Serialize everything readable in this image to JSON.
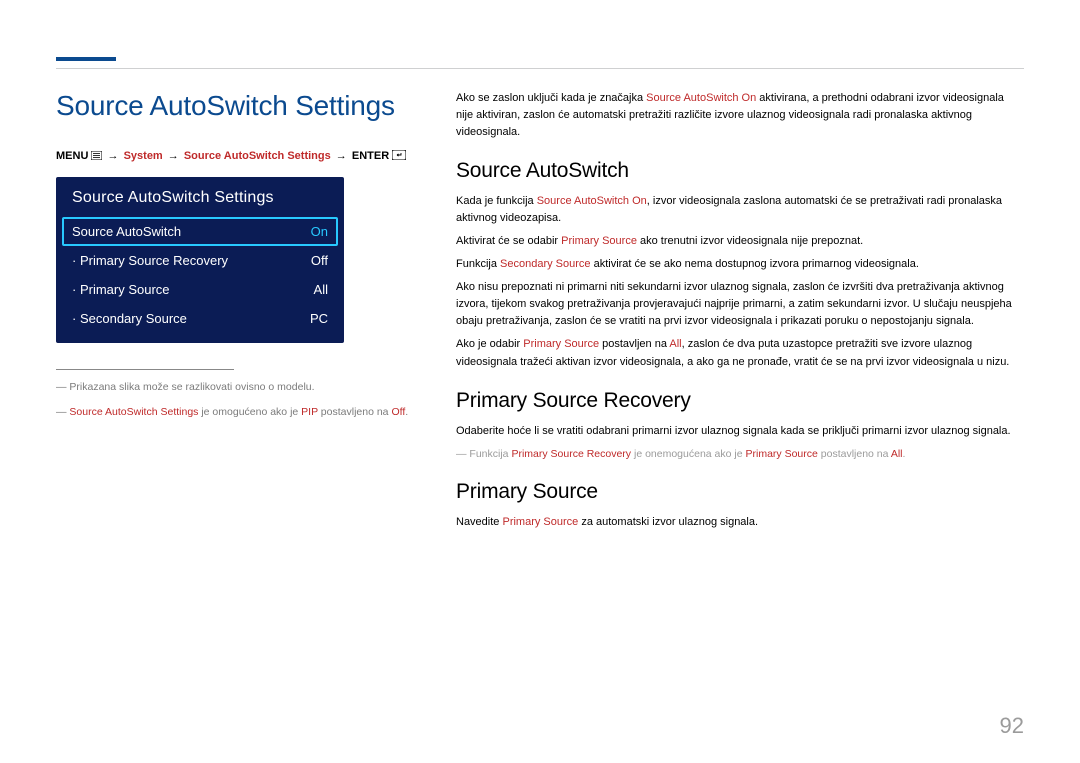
{
  "page_number": "92",
  "left": {
    "title": "Source AutoSwitch Settings",
    "breadcrumb": {
      "p0": "MENU",
      "p1": "System",
      "p2": "Source AutoSwitch Settings",
      "p3": "ENTER"
    },
    "osd": {
      "title": "Source AutoSwitch Settings",
      "rows": [
        {
          "label": "Source AutoSwitch",
          "value": "On"
        },
        {
          "label": "Primary Source Recovery",
          "value": "Off"
        },
        {
          "label": "Primary Source",
          "value": "All"
        },
        {
          "label": "Secondary Source",
          "value": "PC"
        }
      ]
    },
    "notes": {
      "n0": "Prikazana slika može se razlikovati ovisno o modelu.",
      "n1a": "Source AutoSwitch Settings",
      "n1b": " je omogućeno ako je ",
      "n1c": "PIP",
      "n1d": " postavljeno na ",
      "n1e": "Off",
      "n1f": "."
    }
  },
  "right": {
    "intro": {
      "a": "Ako se zaslon uključi kada je značajka ",
      "b": "Source AutoSwitch On",
      "c": " aktivirana, a prethodni odabrani izvor videosignala nije aktiviran, zaslon će automatski pretražiti različite izvore ulaznog videosignala radi pronalaska aktivnog videosignala."
    },
    "h1": "Source AutoSwitch",
    "s1p1": {
      "a": "Kada je funkcija ",
      "b": "Source AutoSwitch On",
      "c": ", izvor videosignala zaslona automatski će se pretraživati radi pronalaska aktivnog videozapisa."
    },
    "s1p2": {
      "a": "Aktivirat će se odabir ",
      "b": "Primary Source",
      "c": " ako trenutni izvor videosignala nije prepoznat."
    },
    "s1p3": {
      "a": "Funkcija ",
      "b": "Secondary Source",
      "c": " aktivirat će se ako nema dostupnog izvora primarnog videosignala."
    },
    "s1p4": "Ako nisu prepoznati ni primarni niti sekundarni izvor ulaznog signala, zaslon će izvršiti dva pretraživanja aktivnog izvora, tijekom svakog pretraživanja provjeravajući najprije primarni, a zatim sekundarni izvor. U slučaju neuspjeha obaju pretraživanja, zaslon će se vratiti na prvi izvor videosignala i prikazati poruku o nepostojanju signala.",
    "s1p5": {
      "a": "Ako je odabir ",
      "b": "Primary Source",
      "c": " postavljen na ",
      "d": "All",
      "e": ", zaslon će dva puta uzastopce pretražiti sve izvore ulaznog videosignala tražeći aktivan izvor videosignala, a ako ga ne pronađe, vratit će se na prvi izvor videosignala u nizu."
    },
    "h2": "Primary Source Recovery",
    "s2p1": "Odaberite hoće li se vratiti odabrani primarni izvor ulaznog signala kada se priključi primarni izvor ulaznog signala.",
    "s2n": {
      "a": "Funkcija ",
      "b": "Primary Source Recovery",
      "c": " je onemogućena ako je ",
      "d": "Primary Source",
      "e": " postavljeno na ",
      "f": "All",
      "g": "."
    },
    "h3": "Primary Source",
    "s3p1": {
      "a": "Navedite ",
      "b": "Primary Source",
      "c": " za automatski izvor ulaznog signala."
    }
  }
}
